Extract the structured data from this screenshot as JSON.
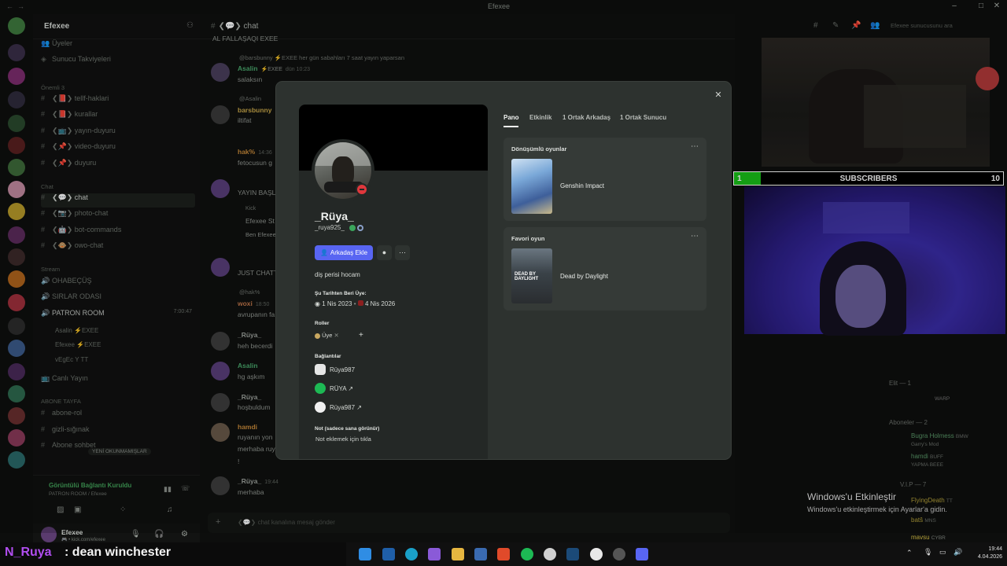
{
  "window": {
    "title": "Efexee"
  },
  "server": {
    "name": "Efexee",
    "top_items": [
      "Üyeler",
      "Sunucu Takviyeleri"
    ],
    "category_1": "Önemli 3",
    "channels_1": [
      "❮📕❯ tellf-haklari",
      "❮📕❯ kurallar",
      "❮📺❯ yayın-duyuru",
      "❮📌❯ video-duyuru",
      "❮📌❯ duyuru"
    ],
    "category_2": "Chat",
    "channels_2": [
      "❮💬❯ chat",
      "❮📷❯ photo-chat",
      "❮🤖❯ bot-commands",
      "❮🐵❯ owo-chat"
    ],
    "category_3": "Stream",
    "voice_channels": [
      "OHABEÇÜŞ",
      "SIRLAR ODASI",
      "PATRON ROOM"
    ],
    "voice_timer": "7:00:47",
    "voice_users": [
      "Asalin ⚡EXEE",
      "Efexee ⚡EXEE",
      "vEgEc Y TT"
    ],
    "live_channel": "Canlı Yayın",
    "category_4": "ABONE TAYFA",
    "channels_4": [
      "abone-rol",
      "gizli-sığınak",
      "Abone sohbet"
    ],
    "new_unreads": "YENİ OKUNMAMIŞLAR",
    "voice_status": "Görüntülü Bağlantı Kuruldu",
    "voice_status_sub": "PATRON ROOM / Efexee",
    "user_name": "Efexee",
    "user_sub": "🎮 • kick.com/efexee"
  },
  "chat": {
    "channel_name": "❮💬❯ chat",
    "search_placeholder": "Efexee sunucusunu ara",
    "input_placeholder": "❮💬❯ chat kanalına mesaj gönder",
    "messages": [
      {
        "text": "AL FALLAŞAQI EXEE"
      },
      {
        "reply": "@barsbunny ⚡EXEE her gün sabahları 7 saat yayın yaparsan"
      },
      {
        "author": "Asalin",
        "tag": "⚡EXEE",
        "time": "dün 10:23",
        "text": "salaksın"
      },
      {
        "reply": "@Asalin"
      },
      {
        "author": "barsbunny",
        "text": "iltifat"
      },
      {
        "author": "hak%",
        "time": "14:36",
        "text": "fetocusun g"
      },
      {
        "text": "YAYIN BAŞL"
      },
      {
        "text": "Kick"
      },
      {
        "text": "Efexee St"
      },
      {
        "text": "Ben Efexee"
      },
      {
        "text": "JUST CHATT"
      },
      {
        "reply": "@hak%"
      },
      {
        "author": "woxi",
        "time": "18:50",
        "text": "avrupanın fa"
      },
      {
        "author": "_Rüya_",
        "text": "heh becerdi"
      },
      {
        "author": "Asalin",
        "tag": "⚡EX",
        "text": "hg aşkım"
      },
      {
        "author": "_Rüya_",
        "text": "hoşbuldum"
      },
      {
        "author": "hamdi",
        "text": "ruyanın yon"
      },
      {
        "text": "merhaba ruy"
      },
      {
        "text": "!"
      },
      {
        "author": "_Rüya_",
        "time": "19:44",
        "text": "merhaba"
      }
    ]
  },
  "profile": {
    "display_name": "_Rüya_",
    "username": "_ruya925_",
    "add_friend": "Arkadaş Ekle",
    "bio": "diş perisi hocam",
    "member_since_label": "Şu Tarihten Beri Üye:",
    "discord_since": "1 Nis 2023",
    "server_since": "4 Nis 2026",
    "roles_label": "Roller",
    "role": "Üye",
    "connections_label": "Bağlantılar",
    "connections": [
      "Rüya987",
      "RÜYA ↗",
      "Rüya987 ↗"
    ],
    "note_label": "Not (sadece sana görünür)",
    "note_placeholder": "Not eklemek için tıkla",
    "tabs": [
      "Pano",
      "Etkinlik",
      "1 Ortak Arkadaş",
      "1 Ortak Sunucu"
    ],
    "card1_title": "Dönüşümlü oyunlar",
    "game1": "Genshin Impact",
    "card2_title": "Favori oyun",
    "game2": "Dead by Daylight",
    "game2_cover_text": "DEAD BY DAYLIGHT"
  },
  "overlay": {
    "subs_label": "SUBSCRIBERS",
    "subs_current": "1",
    "subs_goal": "10",
    "subs_progress": 0.1,
    "stream_user": "N_Ruya",
    "stream_msg": ": dean winchester",
    "activate_title": "Windows'u Etkinleştir",
    "activate_sub": "Windows'u etkinleştirmek için Ayarlar'a gidin."
  },
  "members": [
    {
      "name": "Elit — 1"
    },
    {
      "name": "WARP"
    },
    {
      "name": "Aboneler — 2"
    },
    {
      "name": "Bugra Holmess",
      "tag": "BMW"
    },
    {
      "name": "Garry's Mod"
    },
    {
      "name": "hamdi",
      "tag": "BUFF"
    },
    {
      "name": "YAPMA BEEE"
    },
    {
      "name": "V.I.P — 7"
    },
    {
      "name": "FlyingDeath",
      "tag": "TT"
    },
    {
      "name": "batŝ",
      "tag": "MNS"
    },
    {
      "name": "mavsu",
      "tag": "CYBR"
    }
  ],
  "clock": {
    "time": "19:44",
    "date": "4.04.2026"
  },
  "colors": {
    "accent": "#5865f2",
    "subs_fill": "#19c119",
    "stream_user": "#b14ef0",
    "dnd": "#e0373c"
  }
}
